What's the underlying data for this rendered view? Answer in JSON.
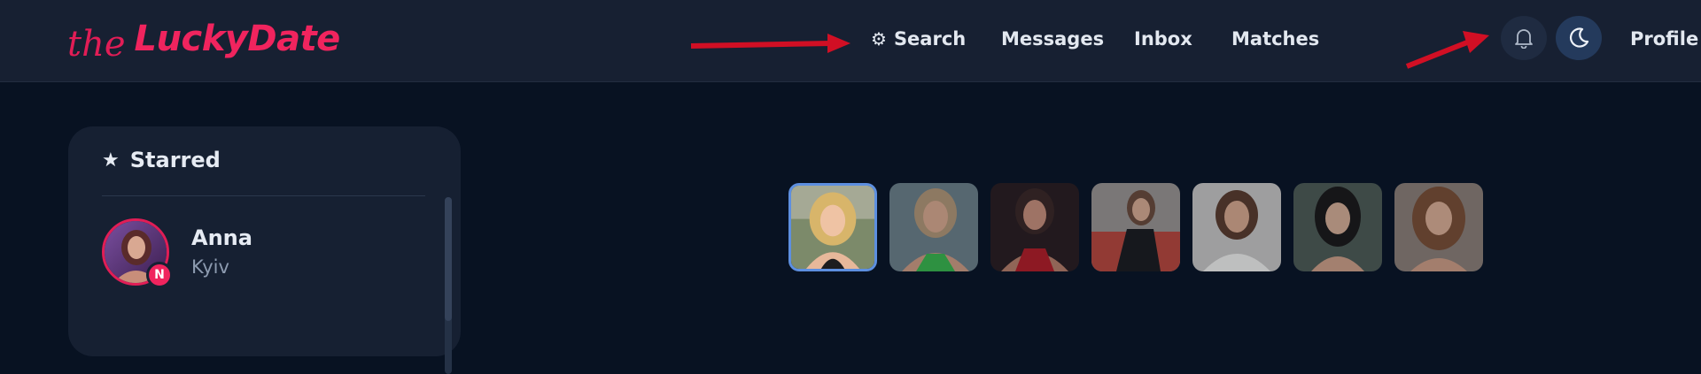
{
  "brand": {
    "prefix": "the",
    "name": "LuckyDate",
    "color": "#f0245e"
  },
  "nav": {
    "items": [
      {
        "label": "Search",
        "icon": "gear-icon"
      },
      {
        "label": "Messages"
      },
      {
        "label": "Inbox"
      },
      {
        "label": "Matches"
      }
    ],
    "notification_icon": "bell-icon",
    "theme_icon": "moon-icon",
    "profile_label": "Profile"
  },
  "sidebar": {
    "title": "Starred",
    "title_icon": "star-icon",
    "contacts": [
      {
        "name": "Anna",
        "city": "Kyiv",
        "badge": "N"
      }
    ]
  },
  "gallery": {
    "count": 7,
    "active_index": 0
  },
  "colors": {
    "accent": "#f0245e",
    "background": "#081222",
    "header": "#172032",
    "panel": "#162032",
    "annotation_arrow": "#d10f24",
    "active_thumb_border": "#5d8fe0"
  }
}
